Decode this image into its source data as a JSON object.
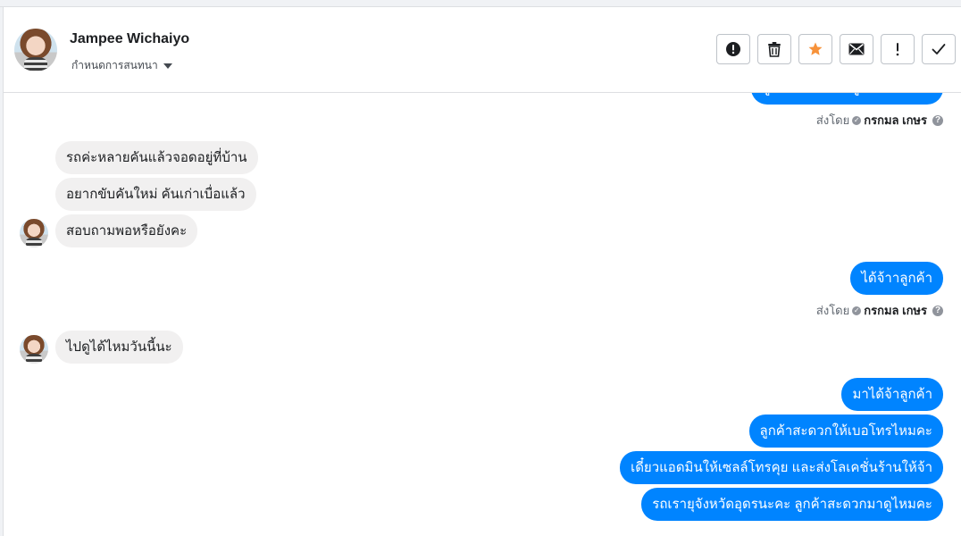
{
  "header": {
    "contact_name": "Jampee Wichaiyo",
    "assign_label": "กำหนดการสนทนา"
  },
  "toolbar": [
    {
      "name": "spam-button",
      "icon": "alert-circle-icon"
    },
    {
      "name": "delete-button",
      "icon": "trash-icon"
    },
    {
      "name": "star-button",
      "icon": "star-icon",
      "color": "#f7923a"
    },
    {
      "name": "mark-unread-button",
      "icon": "envelope-icon"
    },
    {
      "name": "important-button",
      "icon": "exclamation-icon"
    },
    {
      "name": "done-button",
      "icon": "checkmark-icon"
    }
  ],
  "chat": {
    "sent_by_prefix": "ส่งโดย",
    "agent_name": "กรกมล เกษร",
    "top_partial_message": "ลูกค้าสะดวกมาดูรถวันไหนคะ",
    "incoming_1": [
      "รถค่ะหลายคันแล้วจอดอยู่ที่บ้าน",
      "อยากขับคันใหม่  คันเก่าเบื่อแล้ว",
      "สอบถามพอหรือยังคะ"
    ],
    "outgoing_1": "ได้จ้าาลูกค้า",
    "incoming_2": "ไปดูได้ไหมวันนี้นะ",
    "outgoing_2": [
      "มาได้จ้าลูกค้า",
      "ลูกค้าสะดวกให้เบอโทรไหมคะ",
      "เดี๋ยวแอดมินให้เซลล์โทรคุย และส่งโลเคชั่นร้านให้จ้า",
      "รถเรายุจังหวัดอุดรนะคะ  ลูกค้าสะดวกมาดูไหมคะ"
    ],
    "colors": {
      "outgoing": "#0084ff",
      "incoming": "#f1f0f0"
    }
  }
}
